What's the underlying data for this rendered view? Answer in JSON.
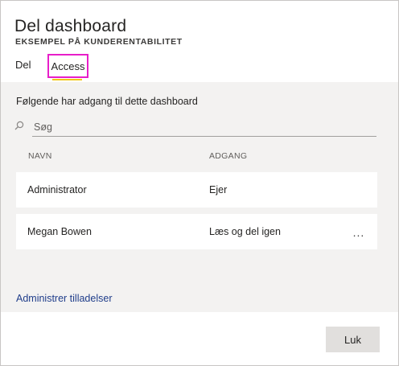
{
  "dialog": {
    "title": "Del dashboard",
    "subtitle": "EKSEMPEL PÅ KUNDERENTABILITET"
  },
  "tabs": [
    {
      "label": "Del"
    },
    {
      "label": "Access",
      "selected": true
    }
  ],
  "access": {
    "intro": "Følgende har adgang til dette dashboard",
    "search": {
      "placeholder": "Søg",
      "value": ""
    },
    "columns": {
      "name": "NAVN",
      "access": "ADGANG"
    },
    "rows": [
      {
        "name": "Administrator",
        "access": "Ejer"
      },
      {
        "name": "Megan Bowen",
        "access": "Læs og del igen",
        "more": "..."
      }
    ]
  },
  "manage_link": "Administrer tilladelser",
  "close_label": "Luk",
  "colors": {
    "highlight_border": "#e81ec9",
    "tab_underline": "#f2c811",
    "link": "#1f3d8a",
    "panel_bg": "#f3f2f1"
  },
  "icons": {
    "search": "search-icon"
  }
}
